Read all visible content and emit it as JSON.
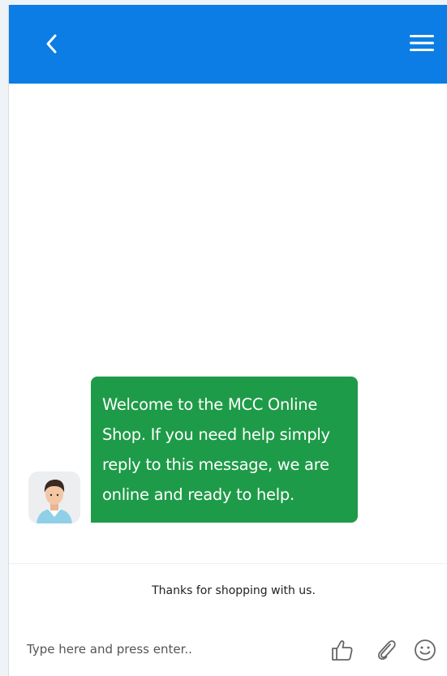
{
  "header": {
    "back_icon": "chevron-left-icon",
    "menu_icon": "hamburger-menu-icon",
    "background": "#0b7de4"
  },
  "chat": {
    "messages": [
      {
        "sender": "agent",
        "avatar_icon": "person-avatar-icon",
        "text": "Welcome to the MCC Online Shop. If you need help simply reply to this message, we are online and ready to help.",
        "bubble_color": "#1e9b48"
      }
    ]
  },
  "footer": {
    "note": "Thanks for shopping with us."
  },
  "composer": {
    "placeholder": "Type here and press enter..",
    "value": "",
    "icons": [
      "thumbs-up-icon",
      "paperclip-icon",
      "emoji-icon"
    ]
  }
}
